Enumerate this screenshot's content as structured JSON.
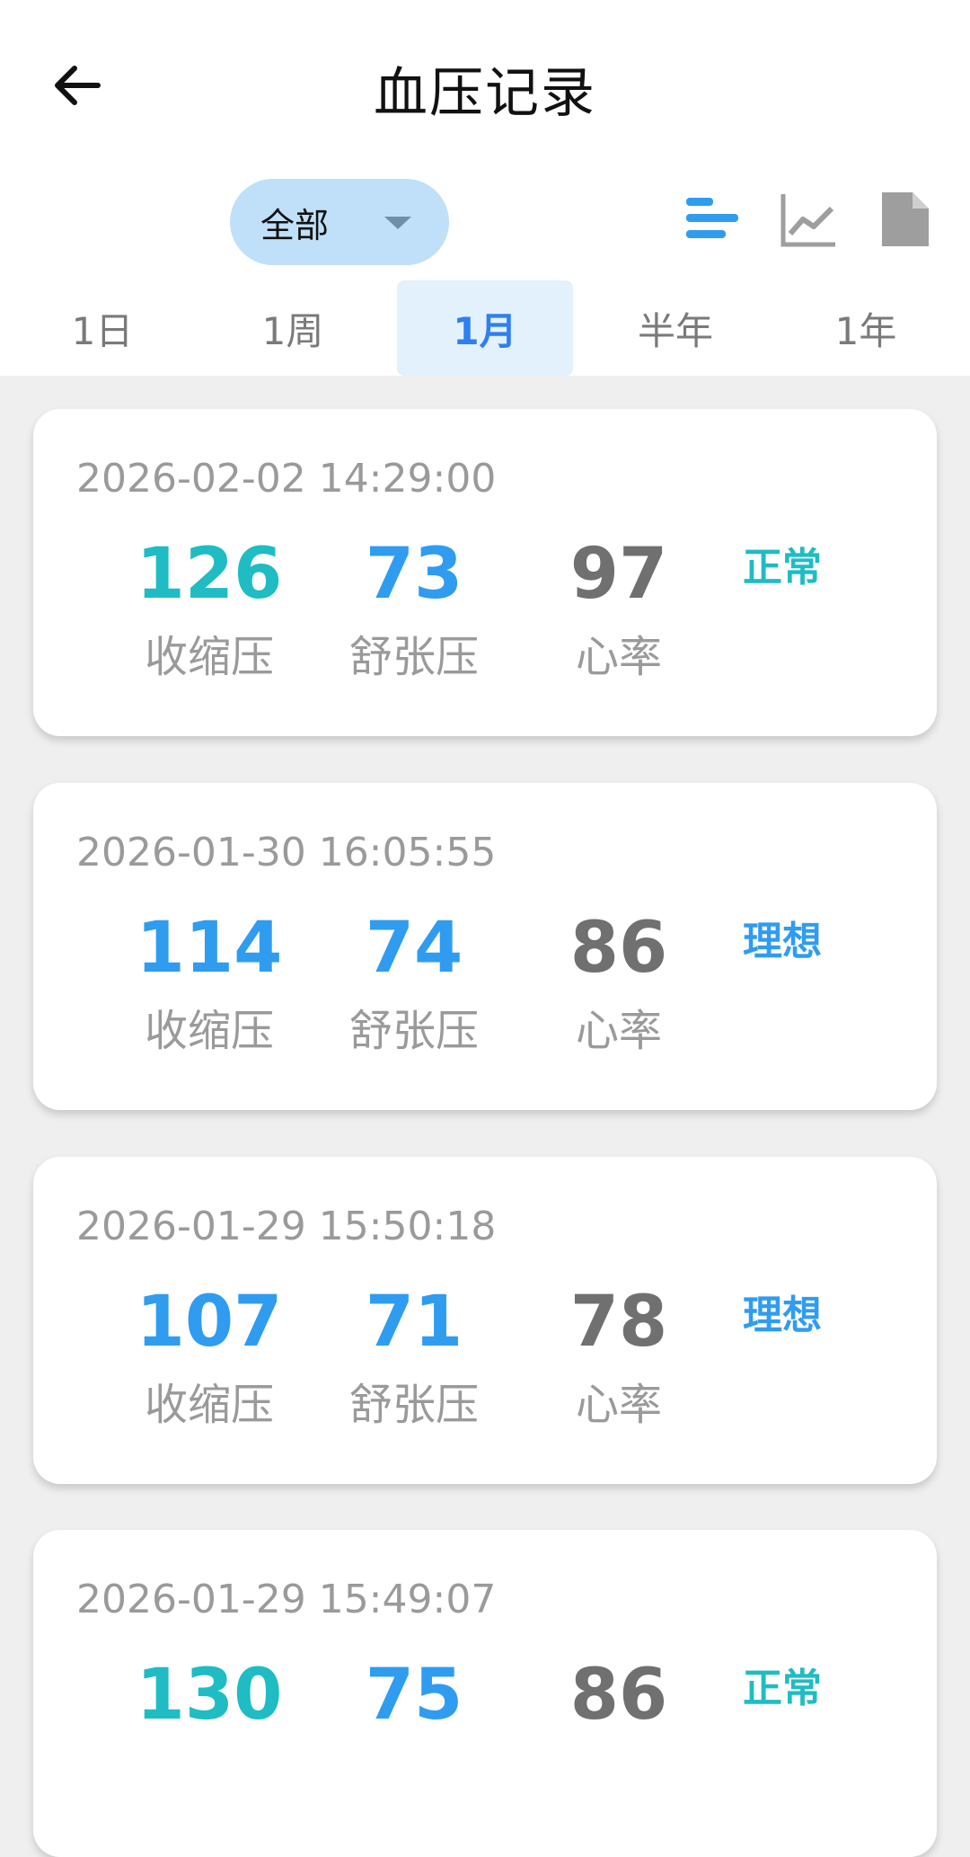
{
  "header": {
    "title": "血压记录",
    "back_icon": "arrow-left-icon"
  },
  "filter": {
    "selected": "全部",
    "arrow_icon": "caret-down-icon"
  },
  "view_modes": [
    {
      "name": "list-view-icon",
      "active": true,
      "color": "#2f9cf0"
    },
    {
      "name": "trend-chart-icon",
      "active": false,
      "color": "#9e9e9e"
    },
    {
      "name": "document-icon",
      "active": false,
      "color": "#9e9e9e"
    }
  ],
  "tabs": [
    {
      "label": "1日",
      "active": false
    },
    {
      "label": "1周",
      "active": false
    },
    {
      "label": "1月",
      "active": true
    },
    {
      "label": "半年",
      "active": false
    },
    {
      "label": "1年",
      "active": false
    }
  ],
  "labels": {
    "systolic": "收缩压",
    "diastolic": "舒张压",
    "heart_rate": "心率"
  },
  "colors": {
    "teal": "#1fbcc4",
    "blue": "#2f9cf0",
    "gray": "#707070"
  },
  "records": [
    {
      "time": "2026-02-02 14:29:00",
      "systolic": "126",
      "diastolic": "73",
      "heart_rate": "97",
      "status": "正常",
      "systolic_color": "#1fbcc4",
      "status_color": "#1fbcc4"
    },
    {
      "time": "2026-01-30 16:05:55",
      "systolic": "114",
      "diastolic": "74",
      "heart_rate": "86",
      "status": "理想",
      "systolic_color": "#2f9cf0",
      "status_color": "#2f9cf0"
    },
    {
      "time": "2026-01-29 15:50:18",
      "systolic": "107",
      "diastolic": "71",
      "heart_rate": "78",
      "status": "理想",
      "systolic_color": "#2f9cf0",
      "status_color": "#2f9cf0"
    },
    {
      "time": "2026-01-29 15:49:07",
      "systolic": "130",
      "diastolic": "75",
      "heart_rate": "86",
      "status": "正常",
      "systolic_color": "#1fbcc4",
      "status_color": "#1fbcc4"
    }
  ]
}
